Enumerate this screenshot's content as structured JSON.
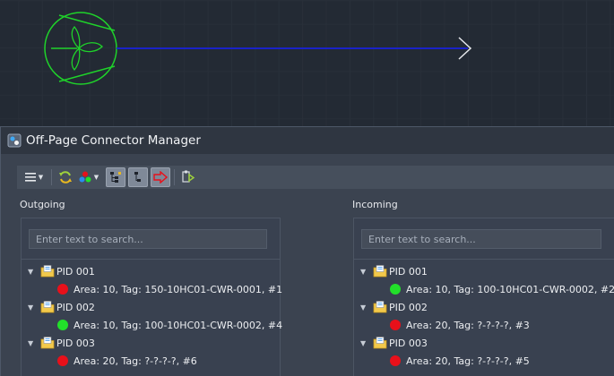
{
  "dialog": {
    "title": "Off-Page Connector Manager"
  },
  "toolbar": {
    "buttons": [
      {
        "icon": "menu-icon",
        "has_dropdown": true
      },
      {
        "icon": "refresh-icon"
      },
      {
        "icon": "color-palette-icon",
        "has_dropdown": true
      },
      {
        "icon": "tree-expand-icon",
        "pressed": true
      },
      {
        "icon": "tree-collapse-icon",
        "pressed": true
      },
      {
        "icon": "arrow-connector-icon",
        "pressed": true
      },
      {
        "icon": "export-connector-icon"
      }
    ]
  },
  "outgoing": {
    "label": "Outgoing",
    "search_placeholder": "Enter text to search...",
    "groups": [
      {
        "name": "PID 001",
        "items": [
          {
            "text": "Area: 10, Tag: 150-10HC01-CWR-0001, #1",
            "status": "red"
          }
        ]
      },
      {
        "name": "PID 002",
        "items": [
          {
            "text": "Area: 10, Tag: 100-10HC01-CWR-0002, #4",
            "status": "green"
          }
        ]
      },
      {
        "name": "PID 003",
        "items": [
          {
            "text": "Area: 20, Tag: ?-?-?-?, #6",
            "status": "red"
          }
        ]
      }
    ]
  },
  "incoming": {
    "label": "Incoming",
    "search_placeholder": "Enter text to search...",
    "groups": [
      {
        "name": "PID 001",
        "items": [
          {
            "text": "Area: 10, Tag: 100-10HC01-CWR-0002, #2",
            "status": "green"
          }
        ]
      },
      {
        "name": "PID 002",
        "items": [
          {
            "text": "Area: 20, Tag: ?-?-?-?, #3",
            "status": "red"
          }
        ]
      },
      {
        "name": "PID 003",
        "items": [
          {
            "text": "Area: 20, Tag: ?-?-?-?, #5",
            "status": "red"
          }
        ]
      }
    ]
  },
  "colors": {
    "status_red": "#e8101a",
    "status_green": "#22e02a",
    "pump_symbol": "#1fd32a",
    "pipe_line": "#1a22c8"
  }
}
